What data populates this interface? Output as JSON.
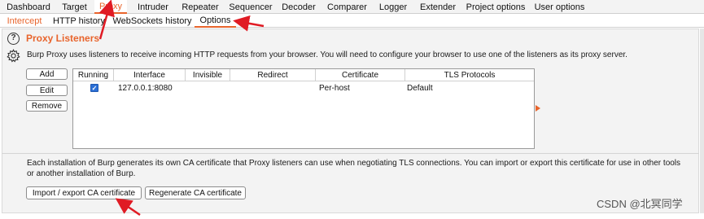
{
  "top_tabs": [
    "Dashboard",
    "Target",
    "Proxy",
    "Intruder",
    "Repeater",
    "Sequencer",
    "Decoder",
    "Comparer",
    "Logger",
    "Extender",
    "Project options",
    "User options"
  ],
  "sub_tabs": [
    "Intercept",
    "HTTP history",
    "WebSockets history",
    "Options"
  ],
  "proxy_listeners": {
    "title": "Proxy Listeners",
    "description": "Burp Proxy uses listeners to receive incoming HTTP requests from your browser. You will need to configure your browser to use one of the listeners as its proxy server.",
    "buttons": {
      "add": "Add",
      "edit": "Edit",
      "remove": "Remove"
    },
    "columns": [
      "Running",
      "Interface",
      "Invisible",
      "Redirect",
      "Certificate",
      "TLS Protocols"
    ],
    "rows": [
      {
        "running": true,
        "interface": "127.0.0.1:8080",
        "invisible": "",
        "redirect": "",
        "certificate": "Per-host",
        "tls_protocols": "Default"
      }
    ]
  },
  "ca": {
    "description": "Each installation of Burp generates its own CA certificate that Proxy listeners can use when negotiating TLS connections. You can import or export this certificate for use in other tools or another installation of Burp.",
    "import_export": "Import / export CA certificate",
    "regenerate": "Regenerate CA certificate"
  },
  "watermark": "CSDN @北冥同学",
  "colors": {
    "accent": "#e8642c",
    "annotation_arrow": "#e01b24",
    "checkbox": "#2b6fd6"
  }
}
